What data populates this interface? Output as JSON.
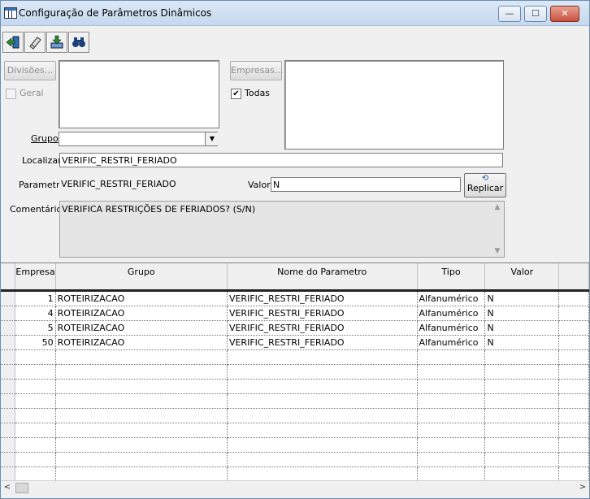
{
  "window": {
    "title": "Configuração de Parâmetros Dinâmicos",
    "min_glyph": "—",
    "max_glyph": "☐",
    "close_glyph": "✕"
  },
  "toolbar": {
    "buttons": [
      {
        "name": "exit-door-icon"
      },
      {
        "name": "eraser-icon"
      },
      {
        "name": "save-download-icon"
      },
      {
        "name": "binoculars-icon"
      }
    ]
  },
  "filters": {
    "divisoes_button": "Divisões...",
    "geral_label": "Geral",
    "geral_checked": false,
    "empresas_button": "Empresas...",
    "todas_label": "Todas",
    "todas_checked": true,
    "check_mark": "✔",
    "grupo_label": "Grupo",
    "grupo_value": "",
    "grupo_arrow": "▼"
  },
  "form": {
    "localizar_label": "Localizar",
    "localizar_value": "VERIFIC_RESTRI_FERIADO",
    "parametro_label": "Parametro",
    "parametro_value": "VERIFIC_RESTRI_FERIADO",
    "valor_label": "Valor",
    "valor_value": "N",
    "replicar_button": "Replicar",
    "replicar_icon": "⟲",
    "comentarios_label": "Comentários",
    "comentarios_value": "VERIFICA RESTRIÇÕES DE FERIADOS? (S/N)",
    "memo_up": "▲",
    "memo_down": "▼"
  },
  "grid": {
    "columns": [
      "Empresa",
      "Grupo",
      "Nome do Parametro",
      "Tipo",
      "Valor"
    ],
    "rows": [
      {
        "empresa": "1",
        "grupo": "ROTEIRIZACAO",
        "nome": "VERIFIC_RESTRI_FERIADO",
        "tipo": "Alfanumérico",
        "valor": "N"
      },
      {
        "empresa": "4",
        "grupo": "ROTEIRIZACAO",
        "nome": "VERIFIC_RESTRI_FERIADO",
        "tipo": "Alfanumérico",
        "valor": "N"
      },
      {
        "empresa": "5",
        "grupo": "ROTEIRIZACAO",
        "nome": "VERIFIC_RESTRI_FERIADO",
        "tipo": "Alfanumérico",
        "valor": "N"
      },
      {
        "empresa": "50",
        "grupo": "ROTEIRIZACAO",
        "nome": "VERIFIC_RESTRI_FERIADO",
        "tipo": "Alfanumérico",
        "valor": "N"
      }
    ],
    "empty_rows": 9
  },
  "scrollbar": {
    "left": "<",
    "right": ">"
  }
}
